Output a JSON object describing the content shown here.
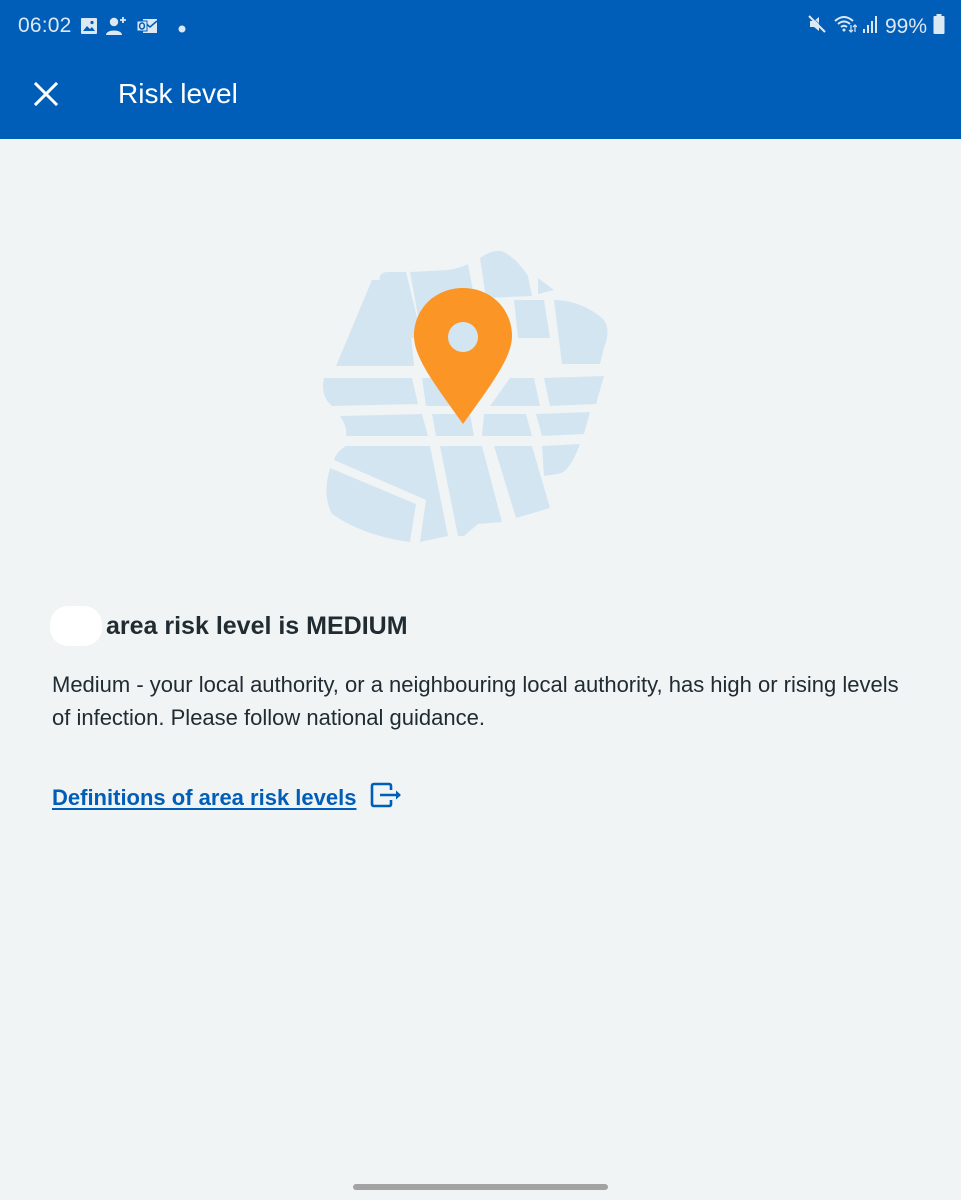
{
  "status_bar": {
    "time": "06:02",
    "left_icons": [
      "gallery-icon",
      "add-contact-icon",
      "outlook-icon",
      "dot-icon"
    ],
    "right_icons": [
      "mute-icon",
      "wifi-icon",
      "signal-icon"
    ],
    "battery_percent": "99%",
    "battery_icon": "battery-icon"
  },
  "app_bar": {
    "close_icon": "close-icon",
    "title": "Risk level"
  },
  "illustration": {
    "name": "map-with-pin",
    "colors": {
      "map_fill": "#d4e5f2",
      "pin": "#fa9526"
    }
  },
  "content": {
    "heading": "area risk level is MEDIUM",
    "risk_level": "MEDIUM",
    "description": "Medium - your local authority, or a neighbouring local authority, has high or rising levels of infection. Please follow national guidance.",
    "link_text": "Definitions of area risk levels",
    "link_icon": "external-link-icon"
  },
  "colors": {
    "brand_blue": "#005eb8",
    "background": "#f0f4f5",
    "text": "#212b32",
    "link": "#005eb8"
  }
}
